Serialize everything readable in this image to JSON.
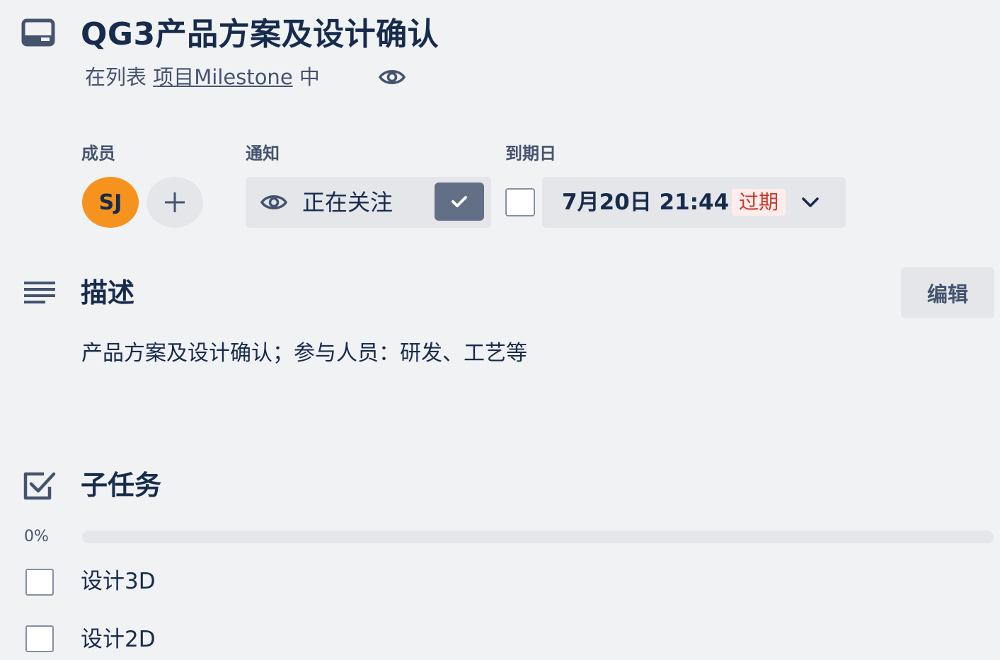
{
  "card": {
    "title": "QG3产品方案及设计确认",
    "list_prefix": "在列表",
    "list_name": "项目Milestone",
    "list_suffix": "中"
  },
  "members": {
    "label": "成员",
    "avatar_initials": "SJ",
    "avatar_color": "#f6931e"
  },
  "notifications": {
    "label": "通知",
    "watch_label": "正在关注",
    "watching": true
  },
  "due_date": {
    "label": "到期日",
    "value": "7月20日 21:44",
    "status_badge": "过期",
    "completed": false,
    "badge_color": "#c9372c"
  },
  "description": {
    "title": "描述",
    "edit_label": "编辑",
    "text": "产品方案及设计确认；参与人员：研发、工艺等"
  },
  "checklist": {
    "title": "子任务",
    "progress_label": "0%",
    "progress_fraction": 0,
    "items": [
      {
        "label": "设计3D",
        "checked": false
      },
      {
        "label": "设计2D",
        "checked": false
      }
    ]
  },
  "icons": {
    "card": "card-icon",
    "watch": "eye-icon",
    "add": "plus-icon",
    "check": "checkmark-icon",
    "chevron": "chevron-down-icon",
    "description": "description-lines-icon",
    "checklist": "checklist-icon"
  }
}
